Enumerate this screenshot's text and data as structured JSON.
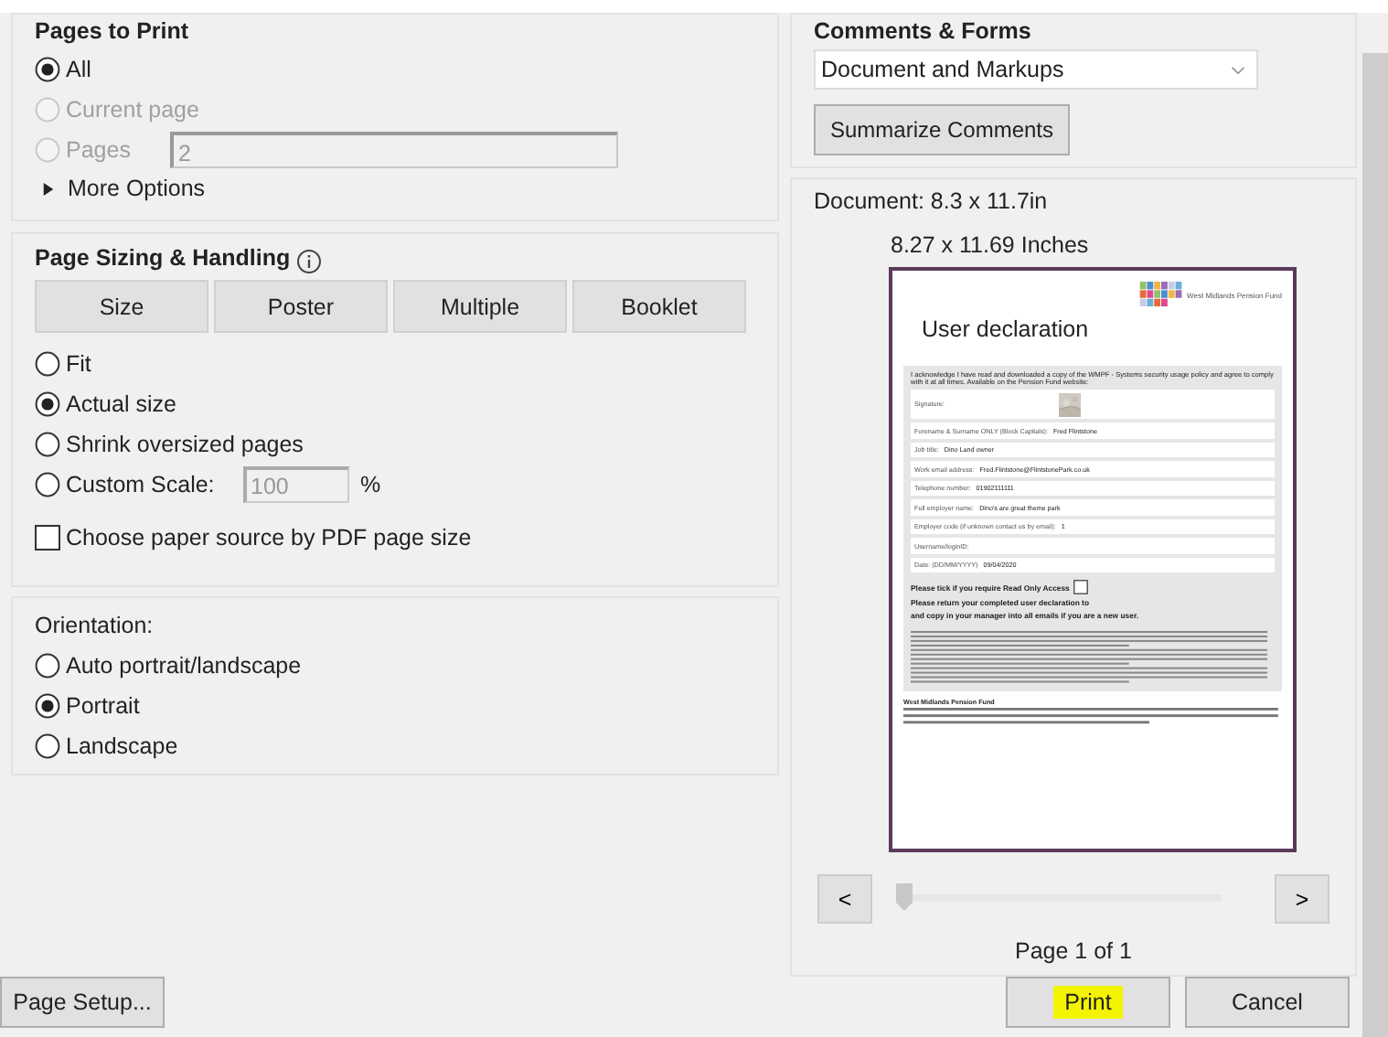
{
  "pages_to_print": {
    "title": "Pages to Print",
    "options": [
      {
        "label": "All",
        "selected": true,
        "disabled": false
      },
      {
        "label": "Current page",
        "selected": false,
        "disabled": true
      },
      {
        "label": "Pages",
        "selected": false,
        "disabled": true
      }
    ],
    "pages_field": {
      "value": "2",
      "disabled": true
    },
    "more_options": {
      "label": "More Options",
      "expanded": false
    }
  },
  "page_sizing": {
    "title": "Page Sizing & Handling",
    "modes": [
      "Size",
      "Poster",
      "Multiple",
      "Booklet"
    ],
    "options": [
      {
        "label": "Fit",
        "selected": false
      },
      {
        "label": "Actual size",
        "selected": true
      },
      {
        "label": "Shrink oversized pages",
        "selected": false
      },
      {
        "label": "Custom Scale:",
        "selected": false
      }
    ],
    "scale_field": {
      "value": "100",
      "unit": "%",
      "disabled": true
    },
    "paper_source": {
      "label": "Choose paper source by PDF page size",
      "checked": false
    }
  },
  "orientation": {
    "title": "Orientation:",
    "options": [
      {
        "label": "Auto portrait/landscape",
        "selected": false
      },
      {
        "label": "Portrait",
        "selected": true
      },
      {
        "label": "Landscape",
        "selected": false
      }
    ]
  },
  "page_setup_button": "Page Setup...",
  "comments_forms": {
    "title": "Comments & Forms",
    "dropdown": {
      "value": "Document and Markups"
    },
    "summarize_button": "Summarize Comments"
  },
  "preview": {
    "document_size": "Document: 8.3 x 11.7in",
    "paper_size": "8.27 x 11.69 Inches",
    "page": {
      "logo_text": "West Midlands Pension Fund",
      "heading": "User declaration",
      "intro": "I acknowledge I have read and downloaded a copy of the WMPF - Systems security usage policy and agree to comply with it at all times. Available on the Pension Fund website:",
      "signature_label": "Signature:",
      "fields": [
        {
          "label": "Forename & Surname ONLY (Block Capitals):",
          "value": "Fred Flintstone"
        },
        {
          "label": "Job title:",
          "value": "Dino Land owner"
        },
        {
          "label": "Work email address:",
          "value": "Fred.Flintstone@FlintstonePark.co.uk"
        },
        {
          "label": "Telephone number:",
          "value": "01902111111"
        },
        {
          "label": "Full employer name:",
          "value": "Dino's are great theme park"
        },
        {
          "label": "Employer code (if unknown contact us by email):",
          "value": "1"
        },
        {
          "label": "Username/loginID:"
        },
        {
          "label": "Date: (DD/MM/YYYY)",
          "value": "09/04/2020"
        }
      ],
      "read_only": {
        "label": "Please tick if you require Read Only Access",
        "checked": false
      },
      "return_text": "Please return your completed user declaration to",
      "return_text_end": "and copy in your manager into all emails if you are a new user.",
      "footer_title": "West Midlands Pension Fund"
    },
    "prev_button": "<",
    "next_button": ">",
    "slider": {
      "level": 0
    },
    "page_label": "Page 1 of 1"
  },
  "buttons": [
    {
      "label": "Print",
      "highlighted": true
    },
    {
      "label": "Cancel",
      "highlighted": false
    }
  ]
}
